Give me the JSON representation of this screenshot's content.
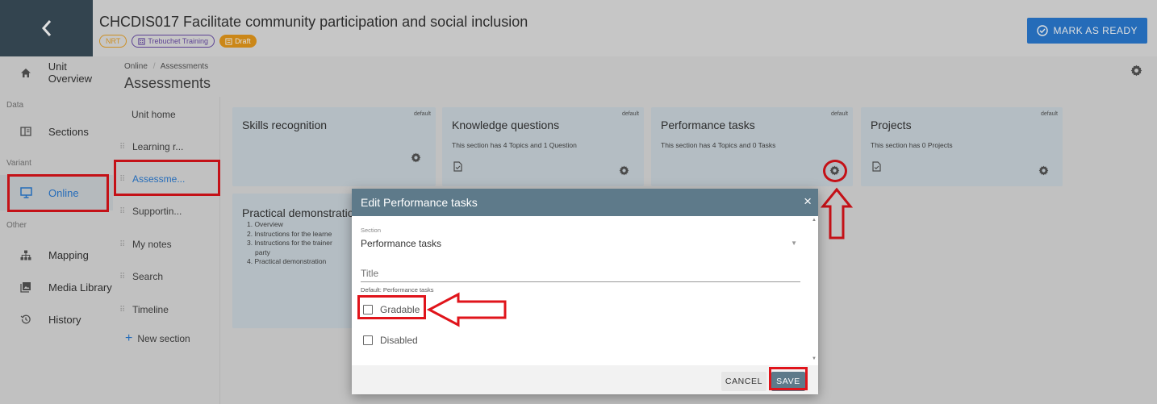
{
  "header": {
    "back_icon": "chevron-left-icon",
    "unit_title": "CHCDIS017 Facilitate community participation and social inclusion",
    "badges": {
      "nrt": "NRT",
      "org": "Trebuchet Training",
      "draft": "Draft"
    },
    "mark_ready_label": "MARK AS READY"
  },
  "nav": {
    "unit_overview": "Unit Overview",
    "group_data": "Data",
    "sections": "Sections",
    "group_variant": "Variant",
    "online": "Online",
    "group_other": "Other",
    "mapping": "Mapping",
    "media_library": "Media Library",
    "history": "History"
  },
  "breadcrumb": {
    "parent": "Online",
    "separator": "/",
    "current": "Assessments"
  },
  "page_title": "Assessments",
  "section_list": {
    "items": [
      "Unit home",
      "Learning r...",
      "Assessme...",
      "Supportin...",
      "My notes",
      "Search",
      "Timeline"
    ],
    "new_section": "New section"
  },
  "cards": {
    "skills": {
      "title": "Skills recognition",
      "tag": "default"
    },
    "knowledge": {
      "title": "Knowledge questions",
      "tag": "default",
      "desc": "This section has 4 Topics and 1 Question"
    },
    "performance": {
      "title": "Performance tasks",
      "tag": "default",
      "desc": "This section has 4 Topics and 0 Tasks"
    },
    "projects": {
      "title": "Projects",
      "tag": "default",
      "desc": "This section has 0 Projects"
    },
    "practical": {
      "title": "Practical demonstratio",
      "items": [
        "1. Overview",
        "2. Instructions for the learne",
        "3. Instructions for the trainer",
        "party",
        "4. Practical demonstration"
      ]
    }
  },
  "modal": {
    "title": "Edit Performance tasks",
    "close": "×",
    "section_label": "Section",
    "section_value": "Performance tasks",
    "title_placeholder": "Title",
    "title_hint": "Default: Performance tasks",
    "gradable_label": "Gradable",
    "disabled_label": "Disabled",
    "cancel_label": "CANCEL",
    "save_label": "SAVE"
  },
  "colors": {
    "accent": "#2b7cd3",
    "header_dark": "#3b4e5a",
    "modal_header": "#5e7a8a",
    "highlight": "#e0141b",
    "draft": "#e89a1c"
  }
}
